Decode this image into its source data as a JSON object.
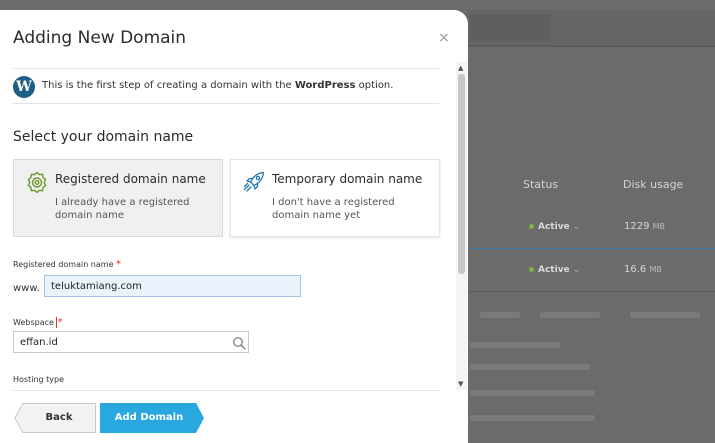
{
  "modal": {
    "title": "Adding New Domain",
    "close_label": "×",
    "info": {
      "text_before": "This is the first step of creating a domain with the ",
      "text_bold": "WordPress",
      "text_after": " option.",
      "icon": "wordpress-icon"
    },
    "section_title": "Select your domain name",
    "cards": [
      {
        "title": "Registered domain name",
        "description": "I already have a registered domain name",
        "icon": "badge-icon",
        "selected": true
      },
      {
        "title": "Temporary domain name",
        "description": "I don't have a registered domain name yet",
        "icon": "rocket-icon",
        "selected": false
      }
    ],
    "fields": {
      "domain": {
        "label": "Registered domain name",
        "required_mark": "*",
        "prefix": "www.",
        "value": "teluktamiang.com"
      },
      "webspace": {
        "label": "Webspace",
        "required_mark": "*",
        "value": "effan.id",
        "icon": "search-icon"
      },
      "hosting_type": {
        "label": "Hosting type"
      }
    },
    "buttons": {
      "back": "Back",
      "add": "Add Domain"
    }
  },
  "background": {
    "columns": [
      "Status",
      "Disk usage"
    ],
    "rows": [
      {
        "status": "Active",
        "disk_value": "1229",
        "disk_unit": "MB"
      },
      {
        "status": "Active",
        "disk_value": "16.6",
        "disk_unit": "MB"
      }
    ]
  },
  "colors": {
    "accent": "#29a8e0",
    "required": "#e0302a",
    "icon_green": "#6b9a2f",
    "icon_blue": "#1f78b4",
    "wordpress": "#1f5f86",
    "status_active": "#7fb545"
  }
}
